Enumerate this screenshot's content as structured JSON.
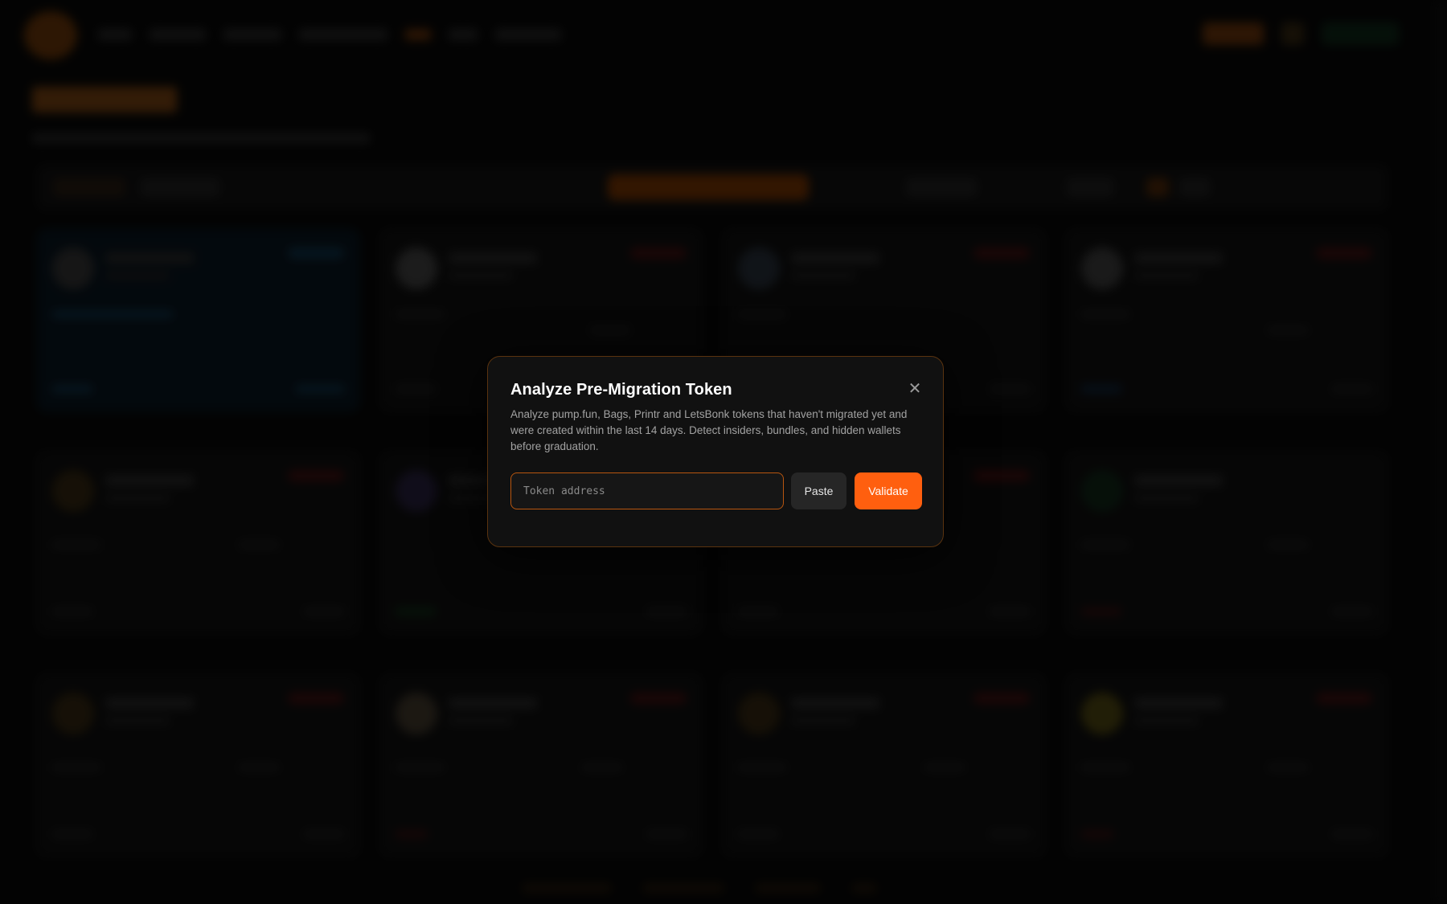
{
  "modal": {
    "title": "Analyze Pre-Migration Token",
    "description": "Analyze pump.fun, Bags, Printr and LetsBonk tokens that haven't migrated yet and were created within the last 14 days. Detect insiders, bundles, and hidden wallets before graduation.",
    "close_icon": "close-icon",
    "input_placeholder": "Token address",
    "input_value": "",
    "paste_label": "Paste",
    "validate_label": "Validate"
  },
  "colors": {
    "accent": "#ff5f0f",
    "modal_border": "#5a330f",
    "input_border": "#b8560f",
    "modal_background": "#111111"
  }
}
